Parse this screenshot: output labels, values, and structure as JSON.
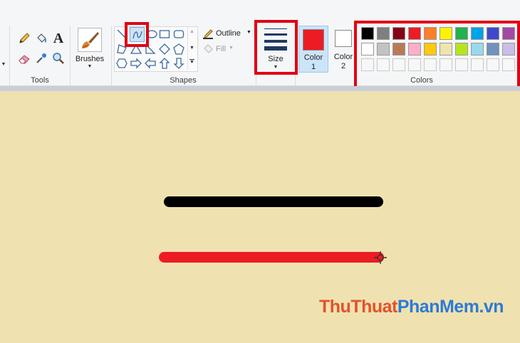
{
  "ribbon": {
    "tools_label": "Tools",
    "brushes_label": "Brushes",
    "shapes_label": "Shapes",
    "outline_label": "Outline",
    "fill_label": "Fill",
    "size_label": "Size",
    "color1_label": "Color",
    "color1_num": "1",
    "color2_label": "Color",
    "color2_num": "2",
    "colors_label": "Colors",
    "color1_value": "#ec1c24",
    "color2_value": "#ffffff"
  },
  "palette": {
    "row1": [
      "#000000",
      "#7f7f7f",
      "#880015",
      "#ed1c24",
      "#ff7f27",
      "#fff200",
      "#22b14c",
      "#00a2e8",
      "#3f48cc",
      "#a349a4"
    ],
    "row2": [
      "#ffffff",
      "#c3c3c3",
      "#b97a57",
      "#ffaec9",
      "#ffc90e",
      "#efe4b0",
      "#b5e61d",
      "#99d9ea",
      "#7092be",
      "#c8bfe7"
    ],
    "row3": [
      "#f7f7f7",
      "#f7f7f7",
      "#f7f7f7",
      "#f7f7f7",
      "#f7f7f7",
      "#f7f7f7",
      "#f7f7f7",
      "#f7f7f7",
      "#f7f7f7",
      "#f7f7f7"
    ]
  },
  "canvas": {
    "line1_color": "#000000",
    "line2_color": "#ec1c24"
  },
  "watermark": {
    "part1": "ThuThuat",
    "part2": "PhanMem",
    "part3": ".vn"
  },
  "icons": [
    "pencil-icon",
    "fill-bucket-icon",
    "text-icon",
    "eraser-icon",
    "color-picker-icon",
    "magnifier-icon",
    "brush-icon",
    "curve-icon",
    "size-lines-icon",
    "crosshair-cursor-icon"
  ]
}
